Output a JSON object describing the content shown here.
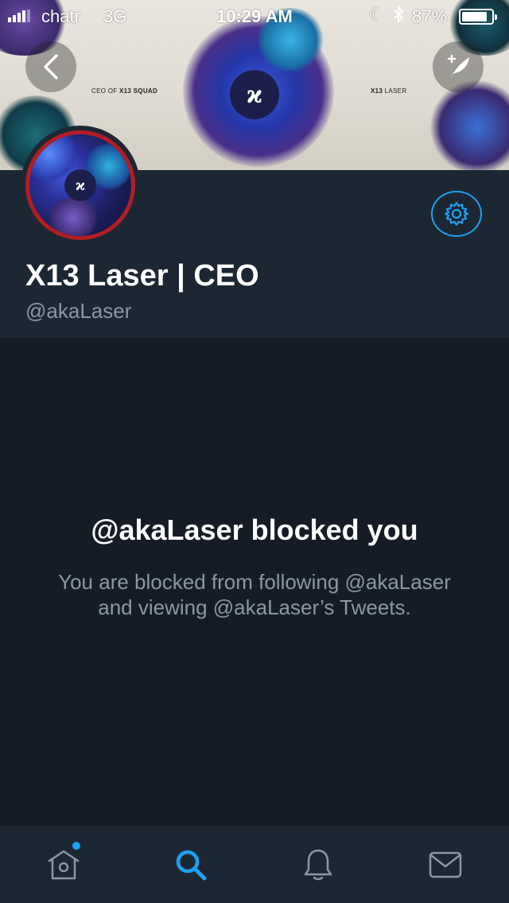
{
  "status_bar": {
    "carrier": "chatr",
    "network": "3G",
    "time": "10:29 AM",
    "battery_percent_label": "87%",
    "battery_level": 0.87
  },
  "banner": {
    "left_text_prefix": "CEO OF ",
    "left_text_bold": "X13 SQUAD",
    "right_text_bold": "X13",
    "right_text_suffix": " LASER",
    "logo_glyph": "ϰ"
  },
  "profile": {
    "display_name": "X13 Laser | CEO",
    "handle": "@akaLaser",
    "avatar_logo_glyph": "ϰ"
  },
  "blocked": {
    "title": "@akaLaser blocked you",
    "description": "You are blocked from following @akaLaser and viewing @akaLaser’s Tweets."
  },
  "tabs": [
    {
      "name": "home",
      "icon": "home-icon",
      "active": false,
      "has_dot": true
    },
    {
      "name": "search",
      "icon": "search-icon",
      "active": true,
      "has_dot": false
    },
    {
      "name": "notifications",
      "icon": "bell-icon",
      "active": false,
      "has_dot": false
    },
    {
      "name": "messages",
      "icon": "envelope-icon",
      "active": false,
      "has_dot": false
    }
  ],
  "colors": {
    "accent": "#1da1f2",
    "background": "#151c26",
    "header_bg": "#1c2733",
    "secondary_text": "#8899a6",
    "avatar_ring": "#b11d25"
  }
}
